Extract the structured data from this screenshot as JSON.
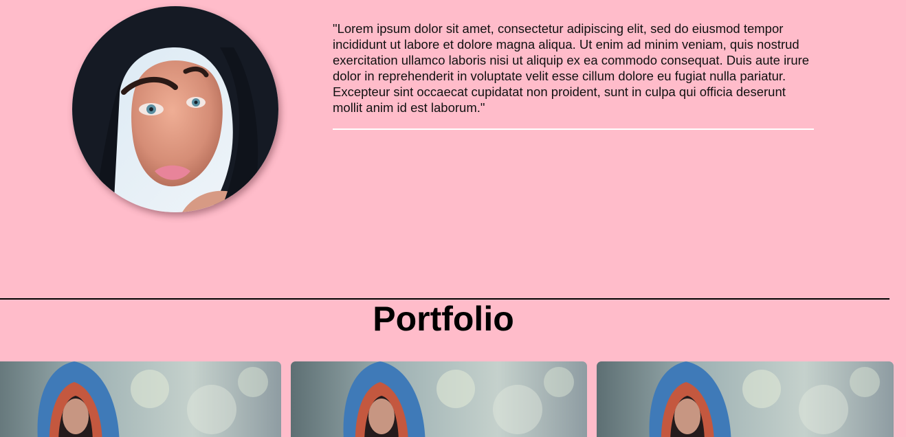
{
  "profile": {
    "image_alt": "Portrait of a woman with long dark hair",
    "quote": "\"Lorem ipsum dolor sit amet, consectetur adipiscing elit, sed do eiusmod tempor incididunt ut labore et dolore magna aliqua. Ut enim ad minim veniam, quis nostrud exercitation ullamco laboris nisi ut aliquip ex ea commodo consequat. Duis aute irure dolor in reprehenderit in voluptate velit esse cillum dolore eu fugiat nulla pariatur. Excepteur sint occaecat cupidatat non proident, sunt in culpa qui officia deserunt mollit anim id est laborum.\""
  },
  "portfolio": {
    "title": "Portfolio",
    "items": [
      {
        "image_alt": "Woman wearing a colorful plaid hood"
      },
      {
        "image_alt": "Woman wearing a colorful plaid hood"
      },
      {
        "image_alt": "Woman wearing a colorful plaid hood"
      }
    ]
  },
  "colors": {
    "background": "#ffbcca",
    "quote_rule": "#ffffff",
    "section_rule": "#000000"
  }
}
